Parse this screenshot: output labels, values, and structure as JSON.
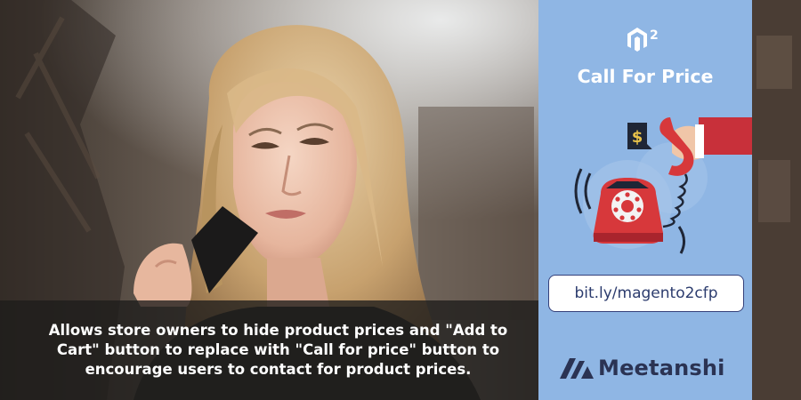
{
  "banner": {
    "caption": "Allows store owners to hide product prices and \"Add to Cart\" button to replace with \"Call for price\" button to encourage users to contact for product prices.",
    "panel": {
      "logo_superscript": "2",
      "title": "Call For Price",
      "price_tag_symbol": "$",
      "short_link": "bit.ly/magento2cfp",
      "brand_name": "Meetanshi"
    },
    "colors": {
      "panel_bg": "#8fb6e4",
      "phone_red": "#d7383b",
      "brand_navy": "#2b3353"
    }
  }
}
